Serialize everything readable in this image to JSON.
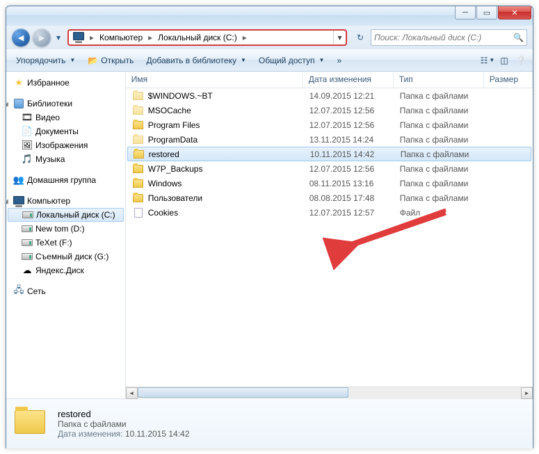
{
  "breadcrumb": {
    "item0": "Компьютер",
    "item1": "Локальный диск (C:)"
  },
  "search": {
    "placeholder": "Поиск: Локальный диск (C:)"
  },
  "toolbar": {
    "organize": "Упорядочить",
    "open": "Открыть",
    "addlib": "Добавить в библиотеку",
    "share": "Общий доступ"
  },
  "sidebar": {
    "favorites": "Избранное",
    "libraries": "Библиотеки",
    "lib_items": {
      "video": "Видео",
      "docs": "Документы",
      "images": "Изображения",
      "music": "Музыка"
    },
    "homegroup": "Домашняя группа",
    "computer": "Компьютер",
    "drives": {
      "c": "Локальный диск (C:)",
      "d": "New tom (D:)",
      "f": "TeXet (F:)",
      "g": "Съемный диск (G:)",
      "y": "Яндекс.Диск"
    },
    "network": "Сеть"
  },
  "columns": {
    "name": "Имя",
    "date": "Дата изменения",
    "type": "Тип",
    "size": "Размер"
  },
  "files": [
    {
      "name": "$WINDOWS.~BT",
      "date": "14.09.2015 12:21",
      "type": "Папка с файлами",
      "hidden": true
    },
    {
      "name": "MSOCache",
      "date": "12.07.2015 12:56",
      "type": "Папка с файлами",
      "hidden": true
    },
    {
      "name": "Program Files",
      "date": "12.07.2015 12:56",
      "type": "Папка с файлами",
      "hidden": false
    },
    {
      "name": "ProgramData",
      "date": "13.11.2015 14:24",
      "type": "Папка с файлами",
      "hidden": true
    },
    {
      "name": "restored",
      "date": "10.11.2015 14:42",
      "type": "Папка с файлами",
      "hidden": false,
      "selected": true
    },
    {
      "name": "W7P_Backups",
      "date": "12.07.2015 12:56",
      "type": "Папка с файлами",
      "hidden": false
    },
    {
      "name": "Windows",
      "date": "08.11.2015 13:16",
      "type": "Папка с файлами",
      "hidden": false
    },
    {
      "name": "Пользователи",
      "date": "08.08.2015 17:48",
      "type": "Папка с файлами",
      "hidden": false
    },
    {
      "name": "Cookies",
      "date": "12.07.2015 12:57",
      "type": "Файл",
      "hidden": false,
      "isfile": true
    }
  ],
  "details": {
    "name": "restored",
    "type": "Папка с файлами",
    "date_label": "Дата изменения:",
    "date": "10.11.2015 14:42"
  }
}
